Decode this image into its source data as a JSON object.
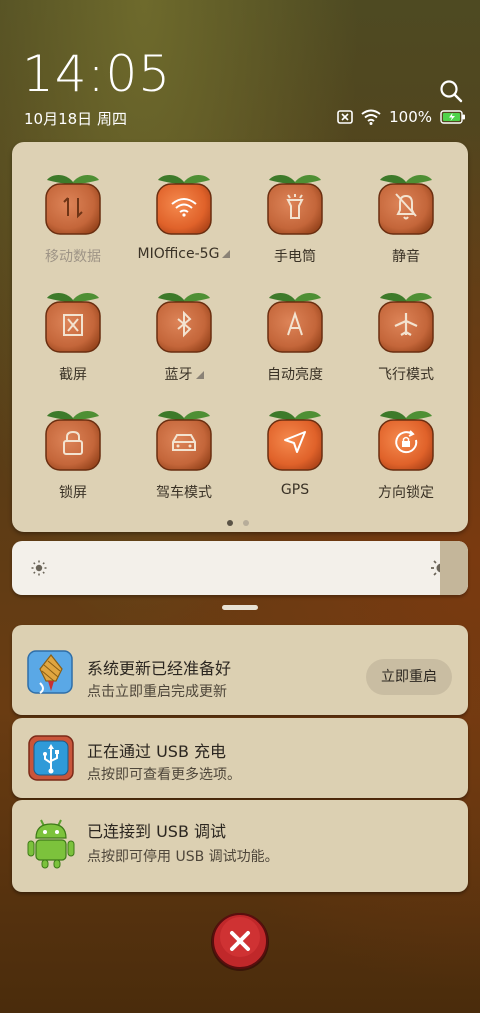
{
  "status": {
    "time": "14:05",
    "date": "10月18日 周四",
    "battery": "100%"
  },
  "tiles": [
    {
      "label": "移动数据",
      "icon": "mobile-data-icon",
      "active": false
    },
    {
      "label": "MIOffice-5G",
      "icon": "wifi-icon",
      "active": true,
      "expand": true
    },
    {
      "label": "手电筒",
      "icon": "flashlight-icon",
      "active": false
    },
    {
      "label": "静音",
      "icon": "mute-icon",
      "active": false
    },
    {
      "label": "截屏",
      "icon": "screenshot-icon",
      "active": false
    },
    {
      "label": "蓝牙",
      "icon": "bluetooth-icon",
      "active": false,
      "expand": true
    },
    {
      "label": "自动亮度",
      "icon": "auto-brightness-icon",
      "active": false
    },
    {
      "label": "飞行模式",
      "icon": "airplane-icon",
      "active": false
    },
    {
      "label": "锁屏",
      "icon": "lock-icon",
      "active": false
    },
    {
      "label": "驾车模式",
      "icon": "car-icon",
      "active": false
    },
    {
      "label": "GPS",
      "icon": "gps-icon",
      "active": true
    },
    {
      "label": "方向锁定",
      "icon": "rotation-lock-icon",
      "active": true
    }
  ],
  "pager": {
    "pages": 2,
    "current": 1
  },
  "brightness": {
    "level": 1.0
  },
  "notifications": [
    {
      "title": "系统更新已经准备好",
      "subtitle": "点击立即重启完成更新",
      "action": "立即重启",
      "icon": "system-update-icon"
    },
    {
      "title": "正在通过 USB 充电",
      "subtitle": "点按即可查看更多选项。",
      "icon": "usb-icon"
    },
    {
      "title": "已连接到 USB 调试",
      "subtitle": "点按即可停用 USB 调试功能。",
      "icon": "android-icon"
    }
  ],
  "colors": {
    "panel": "#ddd1b4",
    "orange_active": "#e4682c",
    "orange_inactive": "#cc6a3a",
    "leaf": "#3d7a2a",
    "close_button": "#c0282a"
  }
}
